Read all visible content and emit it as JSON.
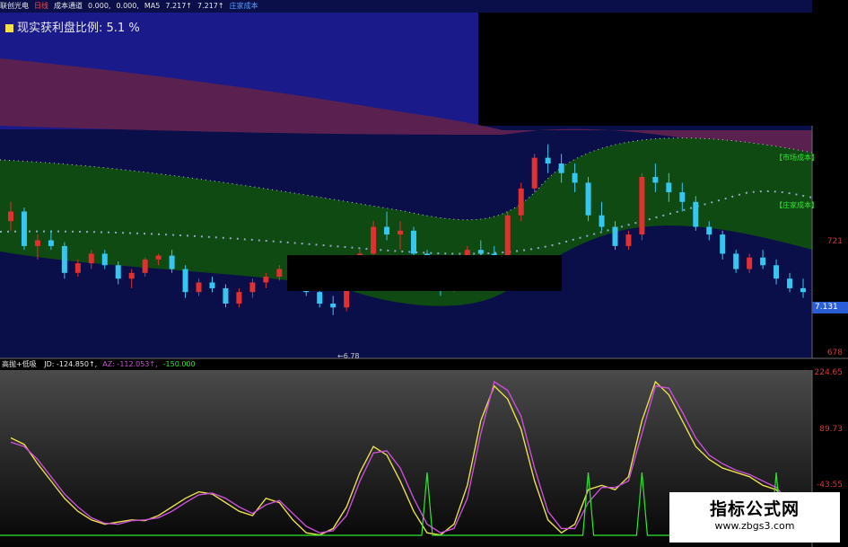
{
  "header": {
    "items": [
      {
        "text": "联创光电",
        "color": "#e8e8e8"
      },
      {
        "text": "日线",
        "color": "#ff4a4a"
      },
      {
        "text": "成本通道",
        "color": "#e8e8e8"
      },
      {
        "text": "0.000,",
        "color": "#e8e8e8"
      },
      {
        "text": "0.000,",
        "color": "#e8e8e8"
      },
      {
        "text": "MA5",
        "color": "#e8e8e8"
      },
      {
        "text": "7.217↑",
        "color": "#e8e8e8"
      },
      {
        "text": "7.217↑",
        "color": "#e8e8e8"
      },
      {
        "text": "庄家成本",
        "color": "#5aa0ff"
      }
    ]
  },
  "profit_label": "现实获利盘比例: 5.1 %",
  "band_labels": {
    "market": "【市场成本】",
    "dealer": "【庄家成本】"
  },
  "price_axis": {
    "ticks": [
      "721",
      "678"
    ],
    "current": "7.131"
  },
  "low_label": "←6.78",
  "sub_header": {
    "title": "高抛+低吸",
    "items": [
      {
        "text": "JD: -124.850↑,",
        "color": "#e8e8e8"
      },
      {
        "text": "AZ: -112.053↑,",
        "color": "#c94fd6"
      },
      {
        "text": "-150.000",
        "color": "#2ee82e"
      }
    ]
  },
  "watermark": {
    "title": "指标公式网",
    "url": "www.zbgs3.com"
  },
  "colors": {
    "up": "#e03030",
    "down": "#35c7f2",
    "jd_line": "#e8e04a",
    "az_line": "#c94fd6",
    "signal_line": "#2ee82e",
    "upper_band": "#5a2150",
    "mid_band": "#0f4a12",
    "lower_bg": "#0a0f4a",
    "top_bg": "#1a1a8a",
    "sub_bg": "#3a3a3a"
  },
  "chart_data": [
    {
      "type": "candlestick",
      "title": "联创光电 日线",
      "ylim": [
        6.6,
        7.7
      ],
      "y_ticks": [
        7.21,
        6.78
      ],
      "candles": [
        [
          7.25,
          7.35,
          7.2,
          7.3
        ],
        [
          7.3,
          7.32,
          7.1,
          7.12
        ],
        [
          7.12,
          7.18,
          7.05,
          7.15
        ],
        [
          7.15,
          7.2,
          7.1,
          7.12
        ],
        [
          7.12,
          7.14,
          6.95,
          6.98
        ],
        [
          6.98,
          7.05,
          6.96,
          7.03
        ],
        [
          7.03,
          7.1,
          7.0,
          7.08
        ],
        [
          7.08,
          7.1,
          7.0,
          7.02
        ],
        [
          7.02,
          7.04,
          6.92,
          6.95
        ],
        [
          6.95,
          7.0,
          6.9,
          6.98
        ],
        [
          6.98,
          7.06,
          6.96,
          7.05
        ],
        [
          7.05,
          7.08,
          7.02,
          7.07
        ],
        [
          7.07,
          7.1,
          6.98,
          7.0
        ],
        [
          7.0,
          7.02,
          6.85,
          6.88
        ],
        [
          6.88,
          6.95,
          6.86,
          6.93
        ],
        [
          6.93,
          6.96,
          6.88,
          6.9
        ],
        [
          6.9,
          6.92,
          6.8,
          6.82
        ],
        [
          6.82,
          6.9,
          6.8,
          6.88
        ],
        [
          6.88,
          6.95,
          6.85,
          6.93
        ],
        [
          6.93,
          6.98,
          6.9,
          6.96
        ],
        [
          6.96,
          7.02,
          6.94,
          7.0
        ],
        [
          7.0,
          7.04,
          6.96,
          6.98
        ],
        [
          6.98,
          7.0,
          6.86,
          6.88
        ],
        [
          6.88,
          6.9,
          6.8,
          6.82
        ],
        [
          6.82,
          6.86,
          6.76,
          6.8
        ],
        [
          6.8,
          6.95,
          6.78,
          6.93
        ],
        [
          6.93,
          7.1,
          6.9,
          7.08
        ],
        [
          7.08,
          7.25,
          7.05,
          7.22
        ],
        [
          7.22,
          7.3,
          7.15,
          7.18
        ],
        [
          7.18,
          7.25,
          7.1,
          7.2
        ],
        [
          7.2,
          7.22,
          7.05,
          7.08
        ],
        [
          7.08,
          7.1,
          6.92,
          6.95
        ],
        [
          6.95,
          6.98,
          6.86,
          6.9
        ],
        [
          6.9,
          7.05,
          6.88,
          7.02
        ],
        [
          7.02,
          7.12,
          7.0,
          7.1
        ],
        [
          7.1,
          7.15,
          7.05,
          7.08
        ],
        [
          7.08,
          7.12,
          7.0,
          7.05
        ],
        [
          7.05,
          7.3,
          7.02,
          7.28
        ],
        [
          7.28,
          7.45,
          7.25,
          7.42
        ],
        [
          7.42,
          7.6,
          7.4,
          7.58
        ],
        [
          7.58,
          7.65,
          7.5,
          7.55
        ],
        [
          7.55,
          7.6,
          7.45,
          7.5
        ],
        [
          7.5,
          7.55,
          7.4,
          7.45
        ],
        [
          7.45,
          7.48,
          7.25,
          7.28
        ],
        [
          7.28,
          7.35,
          7.2,
          7.22
        ],
        [
          7.22,
          7.25,
          7.1,
          7.12
        ],
        [
          7.12,
          7.2,
          7.1,
          7.18
        ],
        [
          7.18,
          7.5,
          7.15,
          7.48
        ],
        [
          7.48,
          7.55,
          7.4,
          7.45
        ],
        [
          7.45,
          7.5,
          7.35,
          7.4
        ],
        [
          7.4,
          7.45,
          7.3,
          7.35
        ],
        [
          7.35,
          7.38,
          7.2,
          7.22
        ],
        [
          7.22,
          7.25,
          7.15,
          7.18
        ],
        [
          7.18,
          7.2,
          7.05,
          7.08
        ],
        [
          7.08,
          7.1,
          6.98,
          7.0
        ],
        [
          7.0,
          7.08,
          6.98,
          7.06
        ],
        [
          7.06,
          7.1,
          7.0,
          7.02
        ],
        [
          7.02,
          7.05,
          6.92,
          6.95
        ],
        [
          6.95,
          6.98,
          6.88,
          6.9
        ],
        [
          6.9,
          6.95,
          6.85,
          6.88
        ]
      ]
    },
    {
      "type": "line",
      "title": "高抛+低吸",
      "ylim": [
        -150,
        224.65
      ],
      "y_ticks": [
        224.65,
        89.73,
        -43.55
      ],
      "series": [
        {
          "name": "JD",
          "color": "#e8e04a",
          "values": [
            80,
            65,
            20,
            -20,
            -60,
            -90,
            -110,
            -120,
            -115,
            -110,
            -112,
            -100,
            -80,
            -60,
            -45,
            -50,
            -70,
            -90,
            -100,
            -60,
            -70,
            -110,
            -140,
            -145,
            -130,
            -80,
            0,
            60,
            40,
            -20,
            -90,
            -140,
            -145,
            -120,
            -30,
            120,
            200,
            170,
            100,
            -20,
            -110,
            -140,
            -120,
            -40,
            -30,
            -40,
            -10,
            120,
            210,
            180,
            120,
            60,
            30,
            10,
            0,
            -10,
            -30,
            -40,
            -80,
            -124.85
          ]
        },
        {
          "name": "AZ",
          "color": "#c94fd6",
          "values": [
            70,
            60,
            30,
            -10,
            -50,
            -80,
            -105,
            -118,
            -120,
            -112,
            -110,
            -105,
            -90,
            -70,
            -52,
            -48,
            -60,
            -80,
            -95,
            -75,
            -65,
            -95,
            -125,
            -140,
            -135,
            -100,
            -20,
            45,
            50,
            10,
            -60,
            -120,
            -140,
            -130,
            -60,
            90,
            210,
            190,
            130,
            10,
            -90,
            -130,
            -130,
            -70,
            -35,
            -35,
            -20,
            90,
            200,
            195,
            140,
            80,
            40,
            20,
            5,
            -5,
            -20,
            -35,
            -70,
            -112.053
          ]
        }
      ],
      "signal_peaks": [
        31,
        43,
        47,
        57
      ]
    }
  ]
}
